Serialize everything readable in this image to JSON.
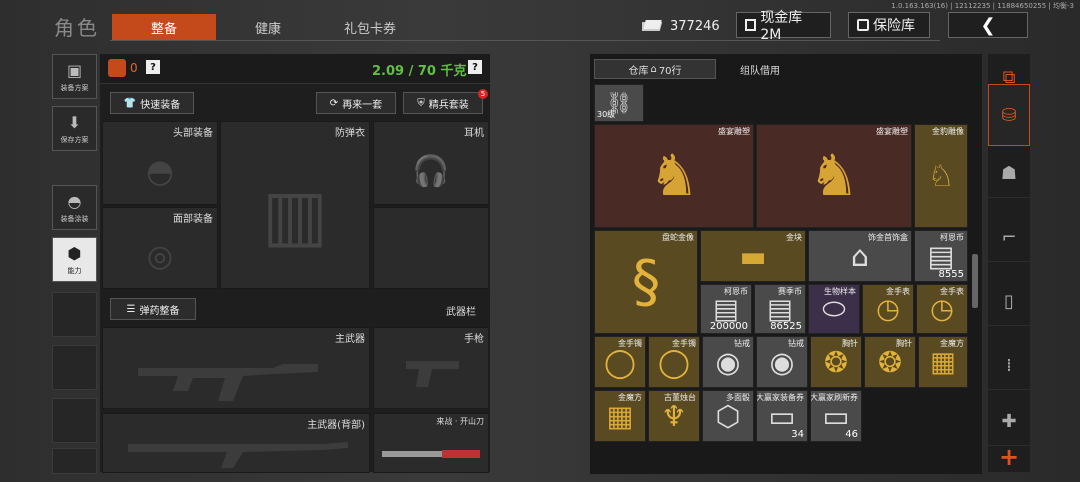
{
  "debug_text": "1.0.163.163(16) | 12112235 | 11884650255 | 均衡-3",
  "header": {
    "role": "角色",
    "tabs": [
      "整备",
      "健康",
      "礼包卡券"
    ],
    "active_tab": 0,
    "currency_value": "377246",
    "cash_btn": "现金库 2M",
    "safe_btn": "保险库"
  },
  "left_sidebar": [
    {
      "label": "装备方案",
      "icon": "vest-icon"
    },
    {
      "label": "保存方案",
      "icon": "download-icon"
    },
    {
      "label": "装备涂装",
      "icon": "helmet-icon"
    },
    {
      "label": "能力",
      "icon": "ability-icon"
    }
  ],
  "loadout": {
    "bag_count": "0",
    "help": "?",
    "weight": "2.09 / 70 千克",
    "help2": "?",
    "quick_equip": "快速装备",
    "again": "再来一套",
    "elite": "精兵套装",
    "elite_badge": "5",
    "slots": {
      "head": "头部装备",
      "armor": "防弹衣",
      "ear": "耳机",
      "face": "面部装备"
    },
    "ammo_btn": "弹药整备",
    "weapon_bar": "武器栏",
    "weapons": {
      "main": "主武器",
      "pistol": "手枪",
      "main_back": "主武器(背部)",
      "melee": "来战 · 开山刀"
    }
  },
  "warehouse": {
    "tab1": "仓库",
    "tab1_rows": "70行",
    "tab2": "组队借用",
    "items": [
      {
        "name": "",
        "qty": "30级"
      },
      {
        "name": "盛宴雕塑",
        "qty": ""
      },
      {
        "name": "盛宴雕塑",
        "qty": ""
      },
      {
        "name": "金豹雕像",
        "qty": ""
      },
      {
        "name": "盘蛇金像",
        "qty": ""
      },
      {
        "name": "金块",
        "qty": ""
      },
      {
        "name": "饰金首饰盒",
        "qty": ""
      },
      {
        "name": "柯恩币",
        "qty": "8555"
      },
      {
        "name": "柯恩币",
        "qty": "200000"
      },
      {
        "name": "赛季币",
        "qty": "86525"
      },
      {
        "name": "生物样本",
        "qty": ""
      },
      {
        "name": "金手表",
        "qty": ""
      },
      {
        "name": "金手表",
        "qty": ""
      },
      {
        "name": "金手镯",
        "qty": ""
      },
      {
        "name": "金手镯",
        "qty": ""
      },
      {
        "name": "钻戒",
        "qty": ""
      },
      {
        "name": "钻戒",
        "qty": ""
      },
      {
        "name": "胸针",
        "qty": ""
      },
      {
        "name": "胸针",
        "qty": ""
      },
      {
        "name": "金魔方",
        "qty": ""
      },
      {
        "name": "金魔方",
        "qty": ""
      },
      {
        "name": "古董烛台",
        "qty": ""
      },
      {
        "name": "多面骰",
        "qty": ""
      },
      {
        "name": "大赢家装备券",
        "qty": "34"
      },
      {
        "name": "大赢家刷新券",
        "qty": "46"
      }
    ]
  },
  "right_bar_plus": "+",
  "colors": {
    "accent": "#c44a1c",
    "gold": "#594a22",
    "red": "#4a2a24",
    "purple": "#3b2f49"
  }
}
